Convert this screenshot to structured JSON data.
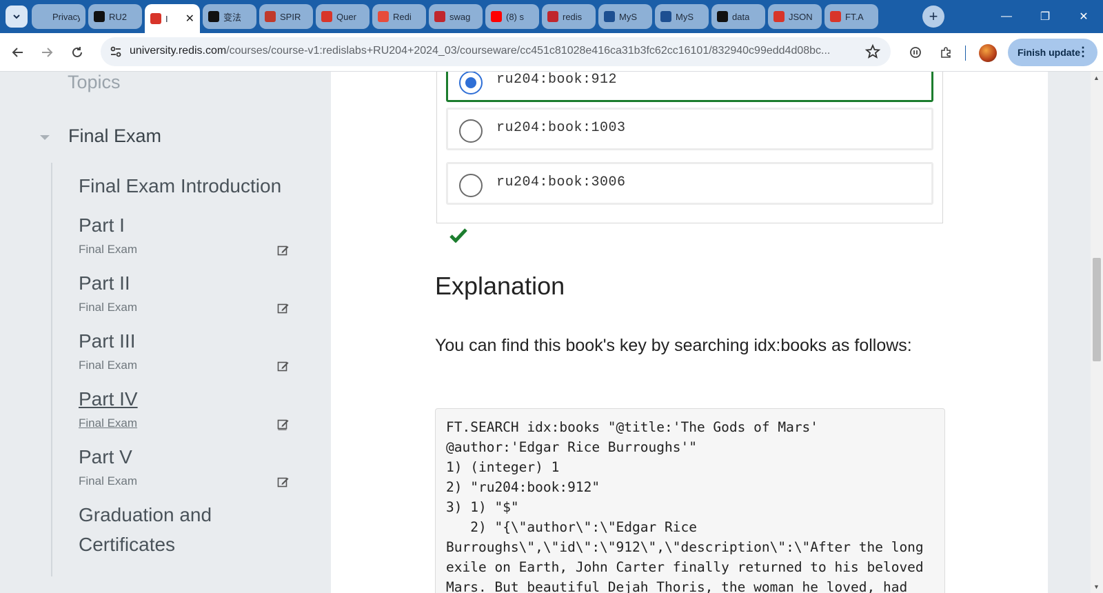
{
  "browser": {
    "tabs": [
      {
        "title": "Privacy a",
        "favicon": "privacy-icon",
        "color": "#8db0d6"
      },
      {
        "title": "RU2",
        "favicon": "github-icon",
        "color": "#111111"
      },
      {
        "title": "I",
        "favicon": "redis-cube-icon",
        "color": "#d8352a",
        "active": true
      },
      {
        "title": "变法",
        "favicon": "chatbot-icon",
        "color": "#111111"
      },
      {
        "title": "SPIR",
        "favicon": "crest-icon",
        "color": "#c0392b"
      },
      {
        "title": "Quer",
        "favicon": "redis-cube-icon",
        "color": "#d8352a"
      },
      {
        "title": "Redi",
        "favicon": "redis-logo-icon",
        "color": "#e74c3c"
      },
      {
        "title": "swag",
        "favicon": "n-icon",
        "color": "#c0262d"
      },
      {
        "title": "(8) s",
        "favicon": "youtube-icon",
        "color": "#ff0000"
      },
      {
        "title": "redis",
        "favicon": "n-icon",
        "color": "#c0262d"
      },
      {
        "title": "MyS",
        "favicon": "mysql-icon",
        "color": "#1d4f91"
      },
      {
        "title": "MyS",
        "favicon": "mysql-icon",
        "color": "#1d4f91"
      },
      {
        "title": "data",
        "favicon": "github-icon",
        "color": "#111111"
      },
      {
        "title": "JSON",
        "favicon": "redis-cube-icon",
        "color": "#d8352a"
      },
      {
        "title": "FT.A",
        "favicon": "redis-cube-icon",
        "color": "#d8352a"
      }
    ],
    "url_domain": "university.redis.com",
    "url_path": "/courses/course-v1:redislabs+RU204+2024_03/courseware/cc451c81028e416ca31b3fc62cc16101/832940c99edd4d08bc...",
    "finish_update_label": "Finish update"
  },
  "sidebar": {
    "topics_label": "Topics",
    "section_title": "Final Exam",
    "items": [
      {
        "title": "Final Exam Introduction",
        "subtitle": ""
      },
      {
        "title": "Part I",
        "subtitle": "Final Exam"
      },
      {
        "title": "Part II",
        "subtitle": "Final Exam"
      },
      {
        "title": "Part III",
        "subtitle": "Final Exam"
      },
      {
        "title": "Part IV",
        "subtitle": "Final Exam"
      },
      {
        "title": "Part V",
        "subtitle": "Final Exam"
      },
      {
        "title": "Graduation and",
        "title2": "Certificates",
        "subtitle": ""
      }
    ]
  },
  "question": {
    "options": [
      {
        "label": "ru204:book:912",
        "selected": true
      },
      {
        "label": "ru204:book:1003",
        "selected": false
      },
      {
        "label": "ru204:book:3006",
        "selected": false
      }
    ]
  },
  "explanation": {
    "title": "Explanation",
    "text": "You can find this book's key by searching idx:books as follows:",
    "code": "FT.SEARCH idx:books \"@title:'The Gods of Mars' @author:'Edgar Rice Burroughs'\"\n1) (integer) 1\n2) \"ru204:book:912\"\n3) 1) \"$\"\n   2) \"{\\\"author\\\":\\\"Edgar Rice Burroughs\\\",\\\"id\\\":\\\"912\\\",\\\"description\\\":\\\"After the long exile on Earth, John Carter finally returned to his beloved Mars. But beautiful Dejah Thoris, the woman he loved, had"
  },
  "colors": {
    "tabstrip": "#1a5ea8",
    "selected_border": "#1c7d2e",
    "radio_selected": "#2f6fd6",
    "checkmark": "#1c7d2e"
  }
}
